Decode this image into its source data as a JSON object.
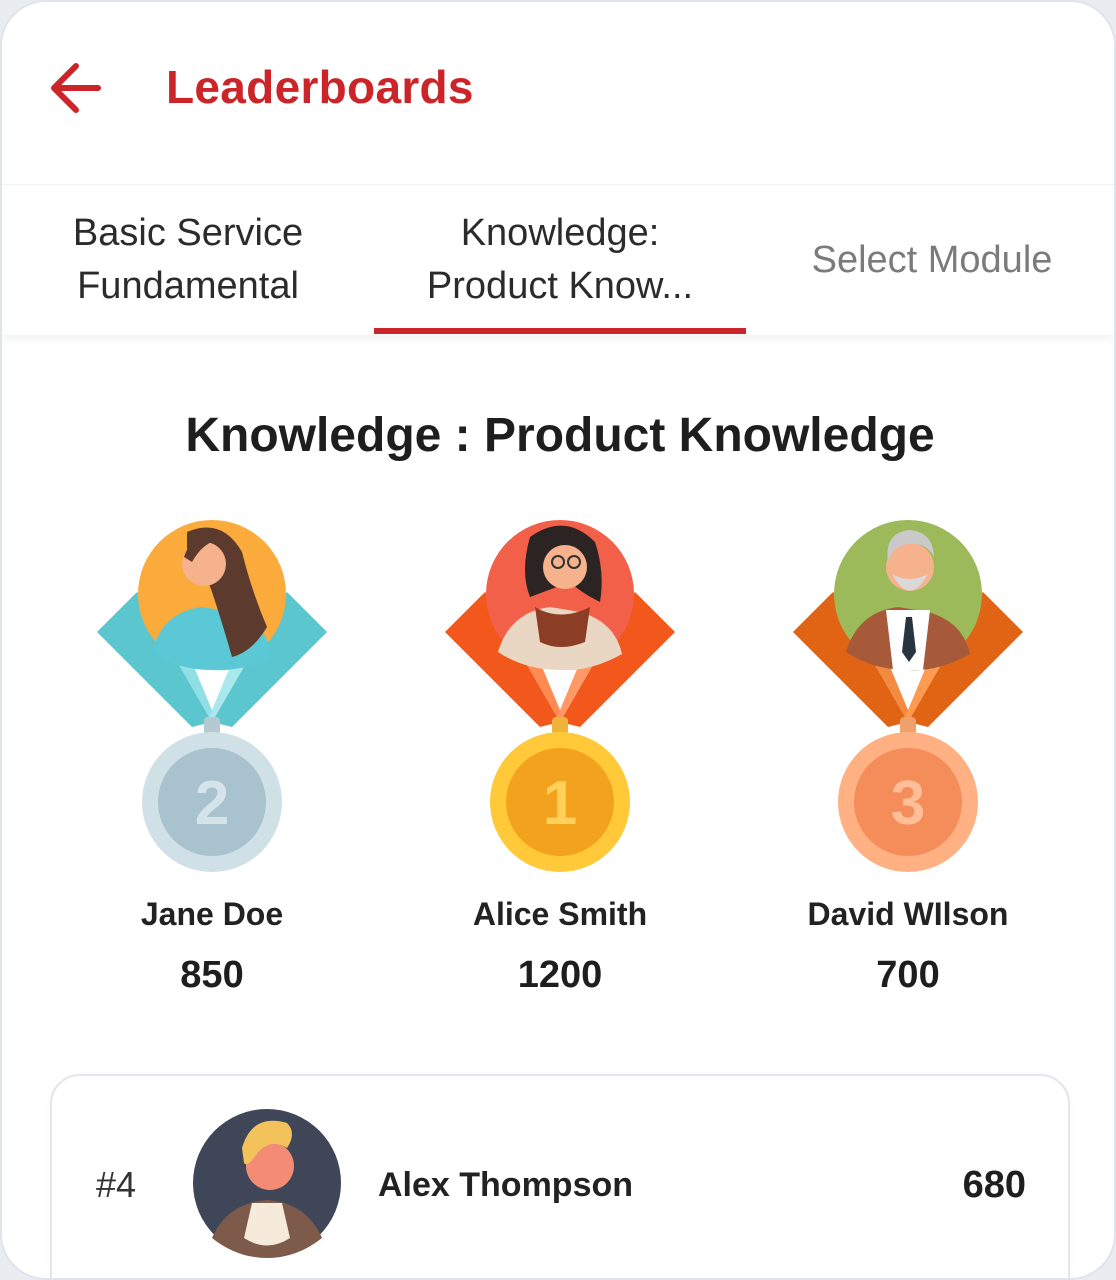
{
  "header": {
    "title": "Leaderboards",
    "back_icon": "arrow-left-icon",
    "accent_color": "#cc2529"
  },
  "tabs": [
    {
      "label": "Basic Service Fundamental",
      "active": false
    },
    {
      "label": "Knowledge: Product Know...",
      "active": true
    },
    {
      "label": "Select Module",
      "active": false
    }
  ],
  "section_title": "Knowledge : Product Knowledge",
  "podium": [
    {
      "rank": 2,
      "name": "Jane Doe",
      "score": "850",
      "medal": "silver"
    },
    {
      "rank": 1,
      "name": "Alice Smith",
      "score": "1200",
      "medal": "gold"
    },
    {
      "rank": 3,
      "name": "David WIlson",
      "score": "700",
      "medal": "bronze"
    }
  ],
  "list": [
    {
      "rank": "#4",
      "name": "Alex Thompson",
      "score": "680"
    }
  ]
}
